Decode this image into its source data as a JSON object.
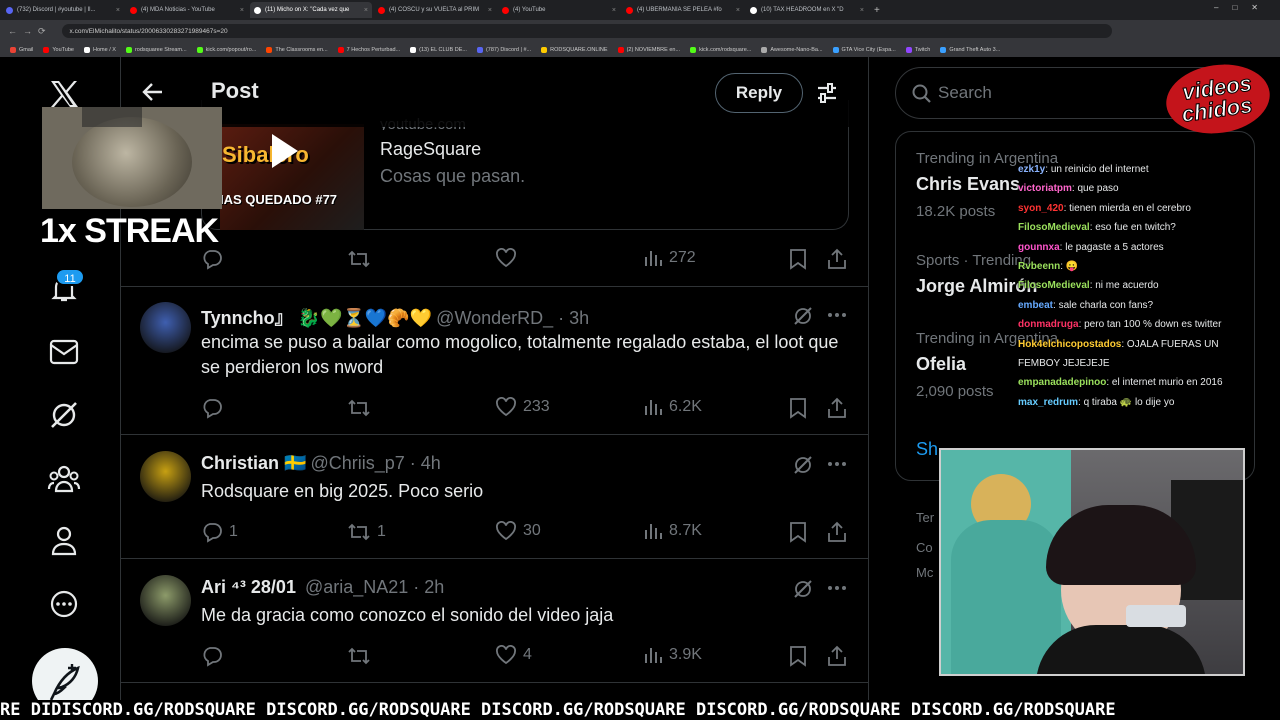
{
  "browser": {
    "tabs": [
      {
        "label": "(732) Discord | #youtube | Il...",
        "color": "#5865f2",
        "active": false
      },
      {
        "label": "(4) MDA Noticias - YouTube",
        "color": "#ff0000",
        "active": false
      },
      {
        "label": "(11) Micho on X: \"Cada vez que",
        "color": "#ffffff",
        "active": true
      },
      {
        "label": "(4) COSCU y su VUELTA al PRIM",
        "color": "#ff0000",
        "active": false
      },
      {
        "label": "(4) YouTube",
        "color": "#ff0000",
        "active": false
      },
      {
        "label": "(4) UBERMANIA SE PELEA #fo",
        "color": "#ff0000",
        "active": false
      },
      {
        "label": "(10) TAX HEADROOM en X \"D",
        "color": "#ffffff",
        "active": false
      }
    ],
    "url": "x.com/ElMichalito/status/20006330283271989467s=20",
    "bookmarks": [
      {
        "label": "Gmail",
        "color": "#ea4335"
      },
      {
        "label": "YouTube",
        "color": "#ff0000"
      },
      {
        "label": "Home / X",
        "color": "#ffffff"
      },
      {
        "label": "rodsquaree Stream...",
        "color": "#53fc18"
      },
      {
        "label": "kick.com/popout/ro...",
        "color": "#53fc18"
      },
      {
        "label": "The Classrooms en...",
        "color": "#ff4500"
      },
      {
        "label": "7 Hechos Perturbad...",
        "color": "#ff0000"
      },
      {
        "label": "(13) EL CLUB DE...",
        "color": "#ffffff"
      },
      {
        "label": "(787) Discord | #...",
        "color": "#5865f2"
      },
      {
        "label": "RODSQUARE.ONLINE",
        "color": "#ffcc00"
      },
      {
        "label": "(2) NOVIEMBRE en...",
        "color": "#ff0000"
      },
      {
        "label": "kick.com/rodsquare...",
        "color": "#53fc18"
      },
      {
        "label": "Awesome-Nano-Ba...",
        "color": "#aaaaaa"
      },
      {
        "label": "GTA Vice City (Espa...",
        "color": "#3aa0ff"
      },
      {
        "label": "Twitch",
        "color": "#9146ff"
      },
      {
        "label": "Grand Theft Auto 3...",
        "color": "#3aa0ff"
      }
    ]
  },
  "nav": {
    "notifications_badge": "11"
  },
  "header": {
    "title": "Post",
    "reply_label": "Reply"
  },
  "card": {
    "domain": "youtube.com",
    "title": "RageSquare",
    "subtitle": "Cosas que pasan.",
    "thumb_text_top": "Sibalero",
    "thumb_text_bottom": "IAS QUEDADO #77",
    "views": "272"
  },
  "posts": [
    {
      "name": "Tynncho』",
      "emojis": "🐉💚⏳💙🥐💛",
      "handle": "@WonderRD_ · 3h",
      "text": "encima se puso a bailar como mogolico, totalmente regalado estaba, el loot que se perdieron los nword",
      "replies": "",
      "reposts": "",
      "likes": "233",
      "views": "6.2K"
    },
    {
      "name": "Christian",
      "emojis": "🇸🇪",
      "handle": "@Chriis_p7 · 4h",
      "text": "Rodsquare en big 2025. Poco serio",
      "replies": "1",
      "reposts": "1",
      "likes": "30",
      "views": "8.7K"
    },
    {
      "name": "Ari ⁴³ 28/01",
      "emojis": "",
      "handle": "@aria_NA21 · 2h",
      "text": "Me da gracia como conozco el sonido del video jaja",
      "replies": "",
      "reposts": "",
      "likes": "4",
      "views": "3.9K"
    }
  ],
  "sidebar": {
    "search_placeholder": "Search",
    "trends": [
      {
        "meta": "Trending in Argentina",
        "title": "Chris Evans",
        "count": "18.2K posts"
      },
      {
        "meta": "Sports · Trending",
        "title": "Jorge Almirón",
        "count": ""
      },
      {
        "meta": "Trending in Argentina",
        "title": "Ofelia",
        "count": "2,090 posts"
      }
    ],
    "show_more": "Sh",
    "footer": [
      "Ter",
      "Co",
      "Mc"
    ]
  },
  "overlay": {
    "streak": "1x STREAK",
    "logo_line1": "videos",
    "logo_line2": "chidos",
    "ticker": "RE DIDISCORD.GG/RODSQUARE DISCORD.GG/RODSQUARE DISCORD.GG/RODSQUARE DISCORD.GG/RODSQUARE DISCORD.GG/RODSQUARE",
    "chat": [
      {
        "user": "ezk1y",
        "color": "#8ab4ff",
        "msg": "un reinicio del internet"
      },
      {
        "user": "victoriatpm",
        "color": "#ff66cc",
        "msg": "que paso"
      },
      {
        "user": "syon_420",
        "color": "#ff3333",
        "msg": "tienen mierda en el cerebro"
      },
      {
        "user": "FilosoMedieval",
        "color": "#9be15d",
        "msg": "eso fue en twitch?"
      },
      {
        "user": "gounnxa",
        "color": "#ff55cc",
        "msg": "le pagaste a 5 actores"
      },
      {
        "user": "Rvbeenn",
        "color": "#9be15d",
        "msg": "😛"
      },
      {
        "user": "FilosoMedieval",
        "color": "#9be15d",
        "msg": "ni me acuerdo"
      },
      {
        "user": "embeat",
        "color": "#66aaff",
        "msg": "sale charla con fans?"
      },
      {
        "user": "donmadruga",
        "color": "#ff3366",
        "msg": "pero tan 100 % down es twitter"
      },
      {
        "user": "Hok4elchicopostados",
        "color": "#ffcc33",
        "msg": "OJALA FUERAS UN FEMBOY JEJEJEJE"
      },
      {
        "user": "empanadadepinoo",
        "color": "#9be15d",
        "msg": "el internet murio en 2016"
      },
      {
        "user": "max_redrum",
        "color": "#66ccff",
        "msg": "q tiraba 🐢 lo dije yo"
      }
    ]
  }
}
